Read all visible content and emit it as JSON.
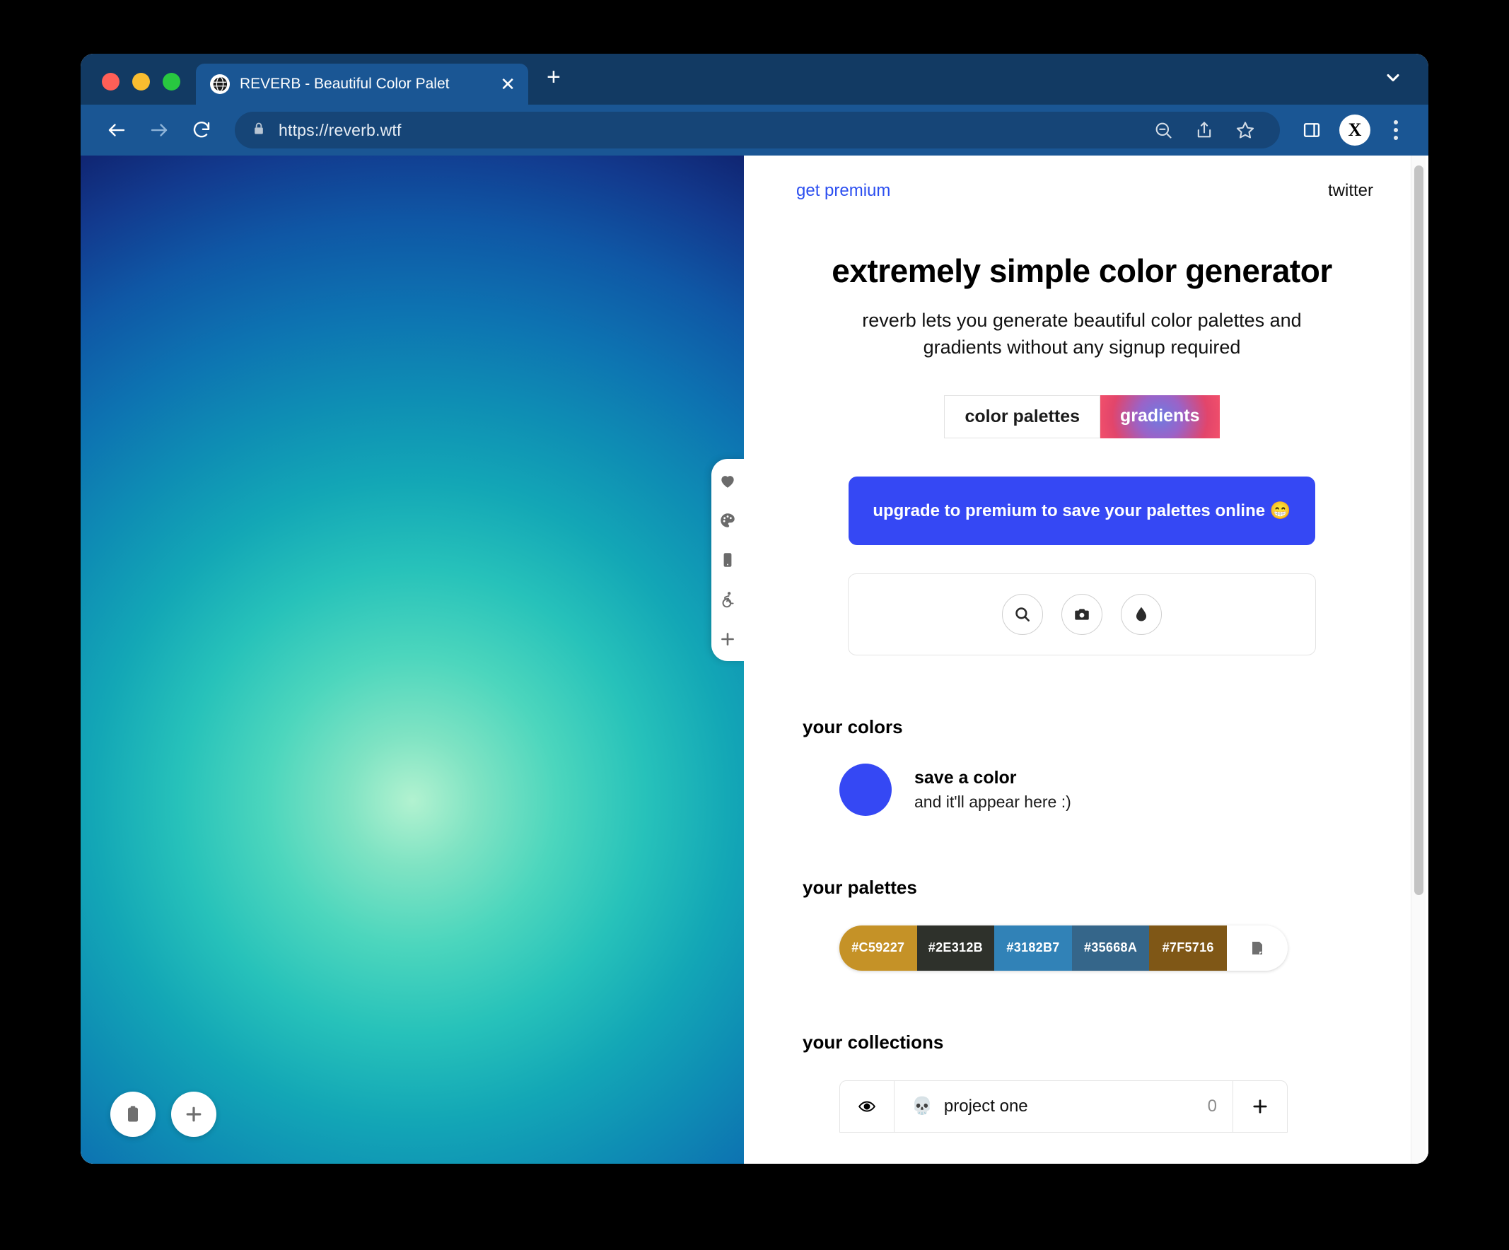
{
  "browser": {
    "tab": {
      "title": "REVERB - Beautiful Color Palet",
      "favicon_icon": "globe-icon",
      "close_icon": "close-icon"
    },
    "new_tab_label": "+",
    "tabstrip_chevron_icon": "chevron-down-icon",
    "nav": {
      "back_icon": "back-arrow-icon",
      "forward_icon": "forward-arrow-icon",
      "reload_icon": "reload-icon"
    },
    "omnibox": {
      "lock_icon": "lock-icon",
      "url": "https://reverb.wtf"
    },
    "actions": {
      "zoom_out_icon": "zoom-out-icon",
      "share_icon": "share-icon",
      "bookmark_icon": "star-icon",
      "sidepanel_icon": "side-panel-icon",
      "avatar_label": "X",
      "menu_icon": "kebab-menu-icon"
    },
    "traffic_lights": [
      "close",
      "minimize",
      "maximize"
    ]
  },
  "preview": {
    "gradient_center": "#B2F2D0",
    "gradient_edge": "#102572",
    "side_tools": [
      {
        "name": "favorite",
        "icon": "heart-icon",
        "glyph": "♥"
      },
      {
        "name": "palette",
        "icon": "palette-icon",
        "glyph": "🎨"
      },
      {
        "name": "mobile-preview",
        "icon": "mobile-icon",
        "glyph": "▯"
      },
      {
        "name": "accessibility",
        "icon": "accessibility-icon",
        "glyph": "♿"
      },
      {
        "name": "add",
        "icon": "plus-icon",
        "glyph": "＋"
      }
    ],
    "corner_buttons": [
      {
        "name": "copy-to-clipboard",
        "icon": "clipboard-icon"
      },
      {
        "name": "add-gradient",
        "icon": "plus-icon"
      }
    ]
  },
  "topbar": {
    "get_premium": "get premium",
    "twitter": "twitter",
    "link_color": "#2B4EF0"
  },
  "hero": {
    "title": "extremely simple color generator",
    "subtitle": "reverb lets you generate beautiful color palettes and gradients without any signup required"
  },
  "tabs": {
    "items": [
      {
        "label": "color palettes",
        "active": false
      },
      {
        "label": "gradients",
        "active": true
      }
    ]
  },
  "cta": {
    "label": "upgrade to premium to save your palettes online 😁",
    "color": "#3548F4"
  },
  "tools": [
    {
      "name": "search",
      "icon": "search-icon"
    },
    {
      "name": "from-photo",
      "icon": "camera-icon"
    },
    {
      "name": "eyedropper",
      "icon": "droplet-icon"
    }
  ],
  "your_colors": {
    "heading": "your colors",
    "swatch_color": "#3548F4",
    "title": "save a color",
    "subtitle": "and it'll appear here :)"
  },
  "your_palettes": {
    "heading": "your palettes",
    "palette": [
      "#C59227",
      "#2E312B",
      "#3182B7",
      "#35668A",
      "#7F5716"
    ],
    "action_icon": "note-icon"
  },
  "your_collections": {
    "heading": "your collections",
    "rows": [
      {
        "visibility_icon": "eye-icon",
        "emoji": "💀",
        "name": "project one",
        "count": "0",
        "add_icon": "plus-icon"
      }
    ]
  }
}
